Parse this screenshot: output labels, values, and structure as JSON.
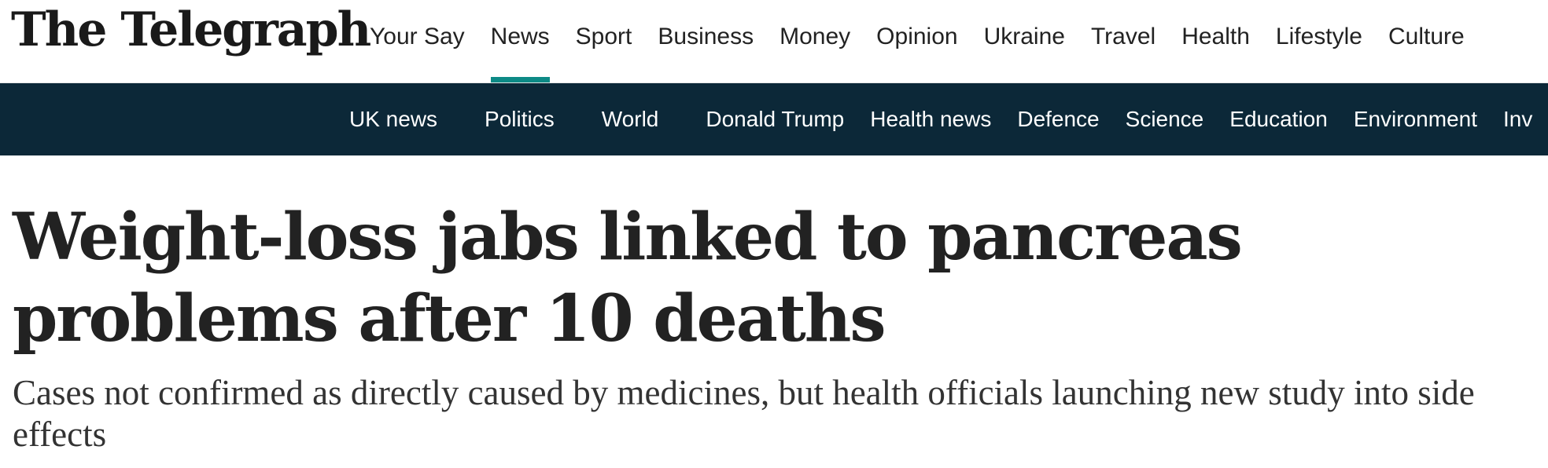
{
  "brand": {
    "name": "The Telegraph",
    "accent_color": "#0d8a86",
    "secondary_nav_bg": "#0c2838"
  },
  "primary_nav": {
    "items": [
      {
        "label": "Your Say"
      },
      {
        "label": "News",
        "active": true
      },
      {
        "label": "Sport"
      },
      {
        "label": "Business"
      },
      {
        "label": "Money"
      },
      {
        "label": "Opinion"
      },
      {
        "label": "Ukraine"
      },
      {
        "label": "Travel"
      },
      {
        "label": "Health"
      },
      {
        "label": "Lifestyle"
      },
      {
        "label": "Culture"
      }
    ]
  },
  "secondary_nav": {
    "items": [
      {
        "label": "UK news"
      },
      {
        "label": "Politics"
      },
      {
        "label": "World"
      },
      {
        "label": "Donald Trump"
      },
      {
        "label": "Health news"
      },
      {
        "label": "Defence"
      },
      {
        "label": "Science"
      },
      {
        "label": "Education"
      },
      {
        "label": "Environment"
      },
      {
        "label": "Inv"
      }
    ]
  },
  "article": {
    "headline": "Weight-loss jabs linked to pancreas problems after 10 deaths",
    "standfirst": "Cases not confirmed as directly caused by medicines, but health officials launching new study into side effects"
  }
}
